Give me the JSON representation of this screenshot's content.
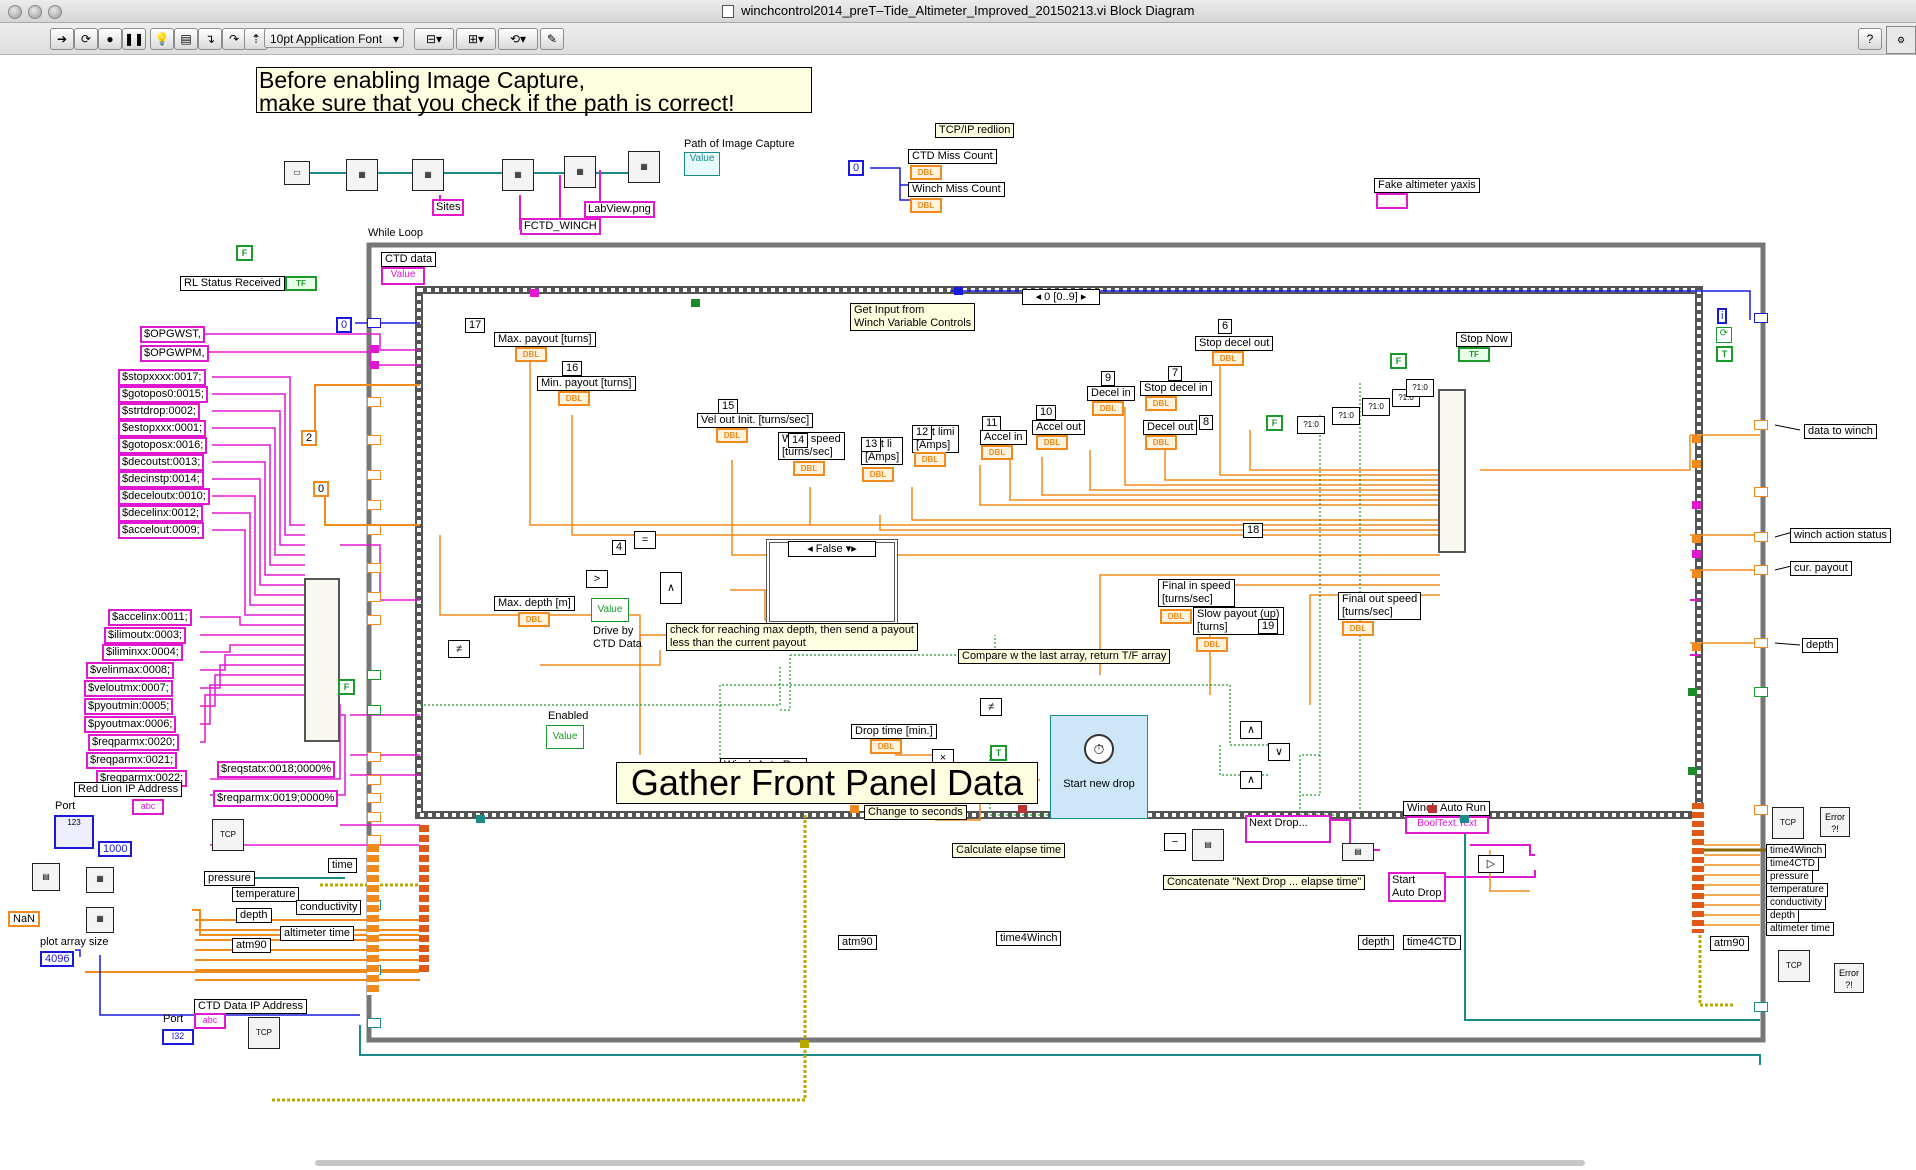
{
  "window": {
    "title": "winchcontrol2014_preT–Tide_Altimeter_Improved_20150213.vi Block Diagram"
  },
  "toolbar": {
    "font": "10pt Application Font",
    "help_label": "?"
  },
  "notes": {
    "image_capture_warning": "Before enabling Image Capture,\nmake sure that you check if the path is correct!",
    "gather": "Gather Front Panel Data",
    "get_input": "Get Input from\nWinch Variable Controls",
    "check_max_depth": "check for reaching max depth, then send a payout\nless than the current payout",
    "compare": "Compare w the last array, return T/F array",
    "change_seconds": "Change to seconds",
    "calc_elapse": "Calculate elapse time",
    "concat": "Concatenate \"Next Drop ... elapse time\""
  },
  "top": {
    "path_label": "Path of Image Capture",
    "path_value": "Value",
    "sites": "Sites",
    "fctd": "FCTD_WINCH",
    "labview": "LabView.png",
    "tcp_redlion": "TCP/IP redlion",
    "ctd_miss": "CTD Miss Count",
    "winch_miss": "Winch Miss Count",
    "zero": "0",
    "fake_alt": "Fake altimeter yaxis",
    "while_loop": "While Loop",
    "rl_status": "RL Status Received",
    "dbl": "DBL",
    "tf": "TF",
    "f": "F",
    "t": "T"
  },
  "commands_left": {
    "top": [
      "$OPGWST,",
      "$OPGWPM,"
    ],
    "group1": [
      "$stopxxxx:0017;",
      "$gotopos0:0015;",
      "$strtdrop:0002;",
      "$estopxxx:0001;",
      "$gotoposx:0016;",
      "$decoutst:0013;",
      "$decinstp:0014;",
      "$deceloutx:0010;",
      "$decelinx:0012;",
      "$accelout:0009;"
    ],
    "group2": [
      "$accelinx:0011;",
      "$ilimoutx:0003;",
      "$iliminxx:0004;",
      "$velinmax:0008;",
      "$veloutmx:0007;",
      "$pyoutmin:0005;",
      "$pyoutmax:0006;",
      "$reqparmx:0020;",
      "$reqparmx:0021;",
      "$reqparmx:0022;"
    ],
    "reqstatx": "$reqstatx:0018;0000%",
    "reqparm19": "$reqparmx:0019;0000%",
    "red_lion": "Red Lion IP Address",
    "port": "Port",
    "port2": "Port",
    "ctd_ip": "CTD Data  IP Address",
    "n1000": "1000",
    "nan": "NaN",
    "plot_size": "plot array size",
    "n4096": "4096",
    "n0": "0",
    "n2": "2",
    "n0b": "0",
    "abc": "abc",
    "i32": "I32",
    "u123": "123"
  },
  "bundle_left": [
    "time",
    "pressure",
    "temperature",
    "conductivity",
    "depth",
    "altimeter time",
    "atm90"
  ],
  "loop": {
    "ctd_data": "CTD data",
    "value": "Value",
    "seq": "0 [0..9]",
    "case_false": "False",
    "n17": "17",
    "n16": "16",
    "n15": "15",
    "n14": "14",
    "n13": "13",
    "n12": "12",
    "n11": "11",
    "n10": "10",
    "n9": "9",
    "n7": "7",
    "n6": "6",
    "n8": "8",
    "n18": "18",
    "n19": "19",
    "n4": "4",
    "n60": "60",
    "max_payout": "Max. payout [turns]",
    "min_payout": "Min. payout [turns]",
    "vel_out_init": "Vel out Init. [turns/sec]",
    "win_speed": "W   n speed\n[turns/sec]",
    "cur_lim_in": "rent li\n[Amps]",
    "cur_lim_out": "rent limi\n[Amps]",
    "accel_in": "Accel  in",
    "accel_out": "Accel out",
    "decel_in": "Decel in",
    "stop_decel_in": "Stop decel in",
    "decel_out": "Decel out",
    "stop_decel_out": "Stop decel out",
    "stop_now": "Stop Now",
    "max_depth": "Max. depth [m]",
    "drive_ctd": "Drive by\nCTD Data",
    "final_in": "Final in speed\n[turns/sec]",
    "slow_payout": "Slow payout (up)\n[turns]",
    "final_out": "Final out speed\n[turns/sec]",
    "enabled": "Enabled",
    "winch_auto_run": "Winch Auto Run",
    "drop_time": "Drop time [min.]",
    "start_new_drop": "Start new drop",
    "next_drop": "Next Drop...",
    "winch_auto_run2": "Winch Auto Run",
    "booltext": "BoolText.Text",
    "start_auto_drop": "Start\nAuto Drop",
    "atm90": "atm90",
    "time4winch": "time4Winch",
    "depth": "depth",
    "time4ctd": "time4CTD",
    "bool": "?1:0"
  },
  "outputs_right": {
    "data_to_winch": "data to winch",
    "winch_status": "winch action status",
    "cur_payout": "cur. payout",
    "depth": "depth",
    "error": "Error",
    "bundle": [
      "time4Winch",
      "time4CTD",
      "pressure",
      "temperature",
      "conductivity",
      "depth",
      "altimeter time"
    ],
    "atm90": "atm90",
    "i": "i"
  },
  "colors": {
    "orange": "#f08a1c",
    "pink": "#e019d0",
    "blue": "#1a1adc",
    "green": "#1a9a2a",
    "teal": "#1a8a8a",
    "yellow_note": "#fdfde0"
  }
}
